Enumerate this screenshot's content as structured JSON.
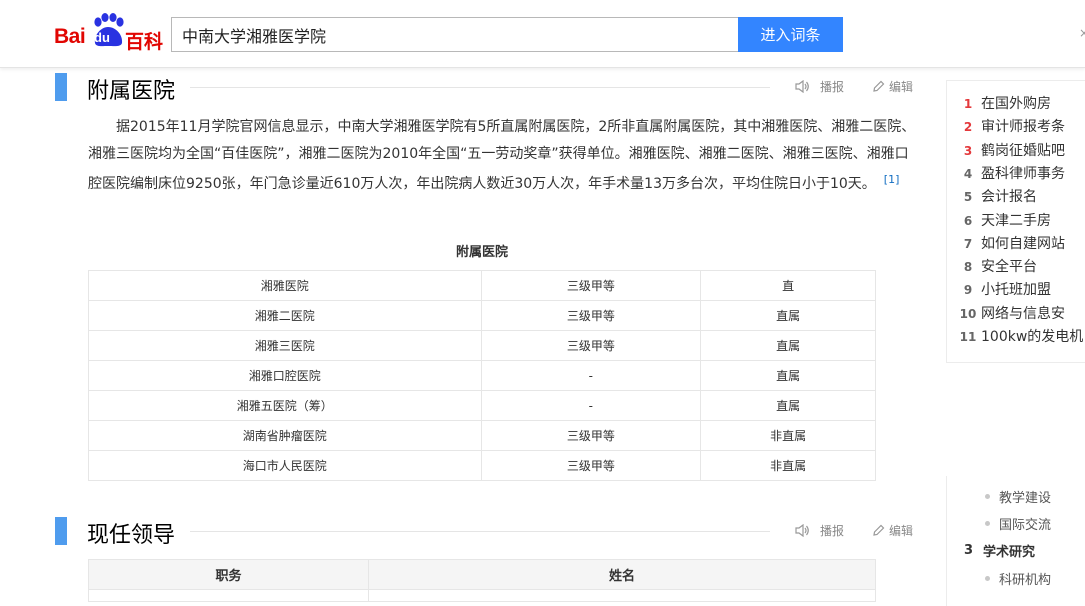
{
  "header": {
    "logo": {
      "text_bai": "Bai",
      "text_du": "du",
      "text_baike": "百科"
    },
    "search": {
      "value": "中南大学湘雅医学院",
      "button_label": "进入词条"
    }
  },
  "section1": {
    "title": "附属医院",
    "tools": {
      "play_label": "播报",
      "edit_label": "编辑"
    },
    "paragraph": "据2015年11月学院官网信息显示，中南大学湘雅医学院有5所直属附属医院，2所非直属附属医院，其中湘雅医院、湘雅二医院、湘雅三医院均为全国“百佳医院”，湘雅二医院为2010年全国“五一劳动奖章”获得单位。湘雅医院、湘雅二医院、湘雅三医院、湘雅口腔医院编制床位9250张，年门急诊量近610万人次，年出院病人数近30万人次，年手术量13万多台次，平均住院日小于10天。",
    "ref": "[1]",
    "table_caption": "附属医院",
    "rows": [
      [
        "湘雅医院",
        "三级甲等",
        "直"
      ],
      [
        "湘雅二医院",
        "三级甲等",
        "直属"
      ],
      [
        "湘雅三医院",
        "三级甲等",
        "直属"
      ],
      [
        "湘雅口腔医院",
        "-",
        "直属"
      ],
      [
        "湘雅五医院（筹）",
        "-",
        "直属"
      ],
      [
        "湖南省肿瘤医院",
        "三级甲等",
        "非直属"
      ],
      [
        "海口市人民医院",
        "三级甲等",
        "非直属"
      ]
    ]
  },
  "section2": {
    "title": "现任领导",
    "tools": {
      "play_label": "播报",
      "edit_label": "编辑"
    },
    "columns": [
      "职务",
      "姓名"
    ]
  },
  "hot_list": [
    {
      "rank": "1",
      "label": "在国外购房"
    },
    {
      "rank": "2",
      "label": "审计师报考条"
    },
    {
      "rank": "3",
      "label": "鹤岗征婚贴吧"
    },
    {
      "rank": "4",
      "label": "盈科律师事务"
    },
    {
      "rank": "5",
      "label": "会计报名"
    },
    {
      "rank": "6",
      "label": "天津二手房"
    },
    {
      "rank": "7",
      "label": "如何自建网站"
    },
    {
      "rank": "8",
      "label": "安全平台"
    },
    {
      "rank": "9",
      "label": "小托班加盟"
    },
    {
      "rank": "10",
      "label": "网络与信息安"
    },
    {
      "rank": "11",
      "label": "100kw的发电机"
    }
  ],
  "toc": {
    "items": [
      {
        "label": "教学建设"
      },
      {
        "label": "国际交流"
      },
      {
        "number": "3",
        "label": "学术研究"
      },
      {
        "label": "科研机构"
      }
    ]
  },
  "colors": {
    "accent": "#3385ff",
    "title_bar": "#4f9cee",
    "logo_red": "#e10602",
    "rank_red": "#e4393c",
    "logo_blue": "#2932e1"
  }
}
